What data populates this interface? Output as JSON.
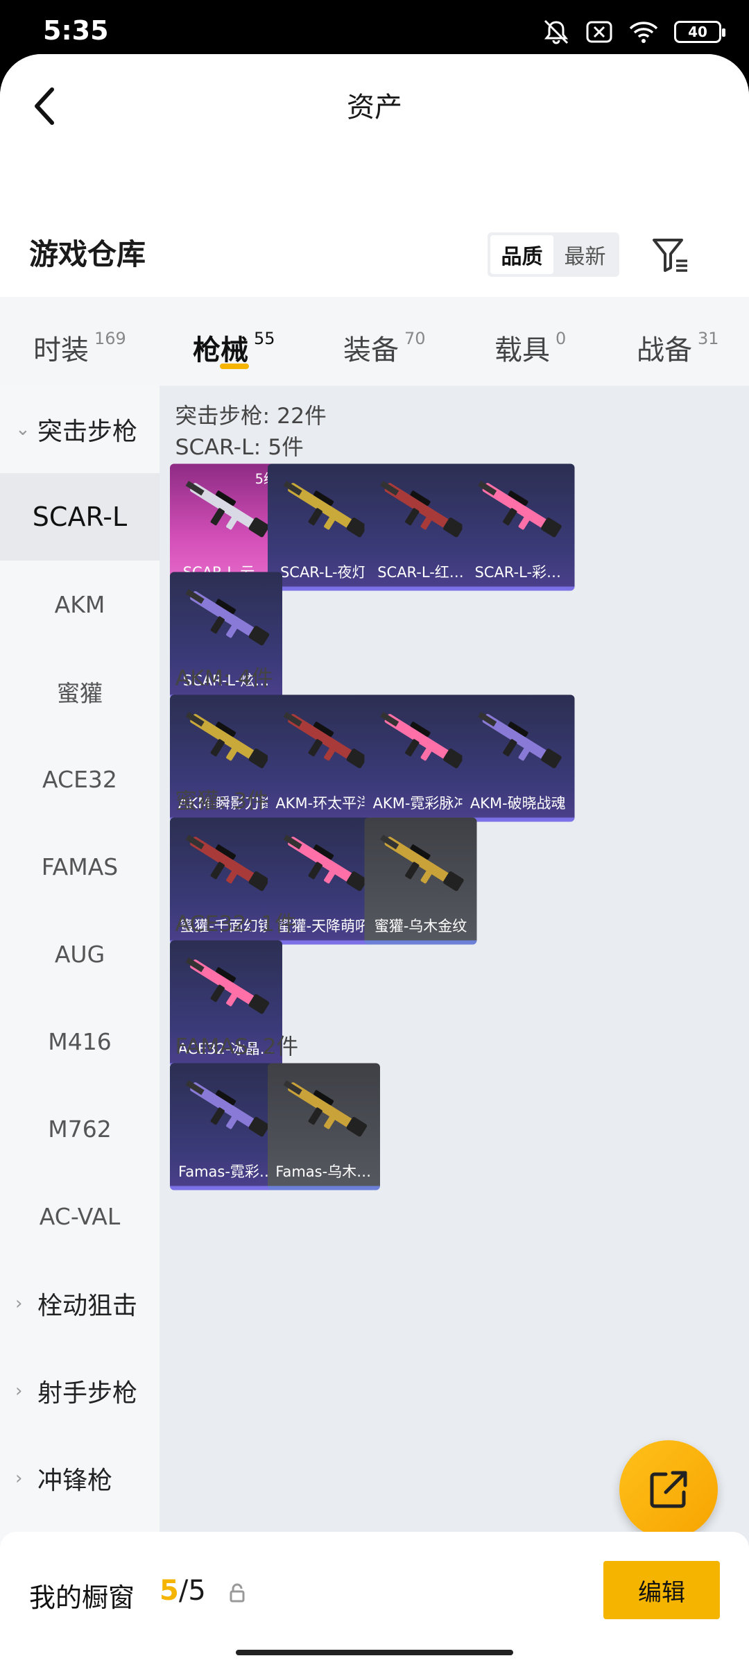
{
  "status": {
    "time": "5:35",
    "battery": "40"
  },
  "header": {
    "title": "资产"
  },
  "warehouse": {
    "title": "游戏仓库",
    "sort_options": [
      "品质",
      "最新"
    ],
    "active_sort": 0
  },
  "tabs": [
    {
      "label": "时装",
      "count": "169"
    },
    {
      "label": "枪械",
      "count": "55"
    },
    {
      "label": "装备",
      "count": "70"
    },
    {
      "label": "载具",
      "count": "0"
    },
    {
      "label": "战备",
      "count": "31"
    }
  ],
  "sidebar": {
    "groups": [
      {
        "label": "突击步枪",
        "expanded": true
      },
      {
        "label": "栓动狙击",
        "expanded": false
      },
      {
        "label": "射手步枪",
        "expanded": false
      },
      {
        "label": "冲锋枪",
        "expanded": false
      }
    ],
    "items": [
      "SCAR-L",
      "AKM",
      "蜜獾",
      "ACE32",
      "FAMAS",
      "AUG",
      "M416",
      "M762",
      "AC-VAL"
    ],
    "selected": "SCAR-L"
  },
  "content": {
    "category_header": "突击步枪: 22件",
    "sections": [
      {
        "header": "SCAR-L: 5件",
        "cards": [
          {
            "name": "SCAR-L-云…",
            "level": "5级",
            "style": "pink"
          },
          {
            "name": "SCAR-L-夜灯",
            "style": "purple"
          },
          {
            "name": "SCAR-L-红…",
            "style": "purple"
          },
          {
            "name": "SCAR-L-彩…",
            "style": "purple"
          },
          {
            "name": "SCAR-L-炫…",
            "style": "purple"
          }
        ]
      },
      {
        "header": "AKM: 4件",
        "cards": [
          {
            "name": "AKM-瞬影刀锋",
            "style": "purple"
          },
          {
            "name": "AKM-环太平洋",
            "style": "purple"
          },
          {
            "name": "AKM-霓彩脉冲",
            "style": "purple"
          },
          {
            "name": "AKM-破晓战魂",
            "style": "purple"
          }
        ]
      },
      {
        "header": "蜜獾: 3件",
        "cards": [
          {
            "name": "蜜獾-千面幻镜",
            "style": "purple"
          },
          {
            "name": "蜜獾-天降萌吼",
            "style": "purple"
          },
          {
            "name": "蜜獾-乌木金纹",
            "style": "gray"
          }
        ]
      },
      {
        "header": "ACE32: 1件",
        "cards": [
          {
            "name": "ACE32-冰晶…",
            "style": "purple"
          }
        ]
      },
      {
        "header": "FAMAS: 2件",
        "cards": [
          {
            "name": "Famas-霓彩…",
            "style": "purple"
          },
          {
            "name": "Famas-乌木…",
            "style": "gray"
          }
        ]
      }
    ]
  },
  "colors": {
    "accent": "#f5b400",
    "card_purple": "#3a3a78",
    "card_pink": "#d24fb8",
    "card_gray": "#55585f"
  },
  "bottom": {
    "showcase_label": "我的橱窗",
    "current": "5",
    "total": "/5",
    "edit_label": "编辑"
  }
}
